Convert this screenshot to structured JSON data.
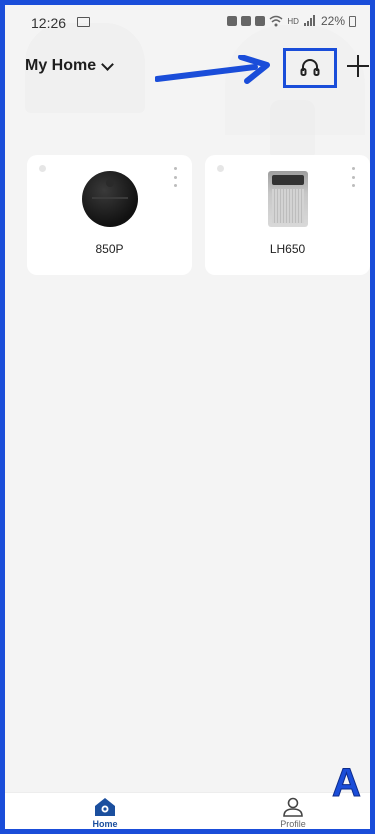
{
  "status_bar": {
    "time": "12:26",
    "network": "HD",
    "battery": "22%"
  },
  "header": {
    "home_title": "My Home"
  },
  "devices": [
    {
      "name": "850P",
      "icon": "robot-vacuum"
    },
    {
      "name": "LH650",
      "icon": "air-purifier"
    }
  ],
  "bottom_nav": {
    "home_label": "Home",
    "profile_label": "Profile"
  },
  "annotation": {
    "letter": "A",
    "color": "#1a4dd9"
  },
  "colors": {
    "accent": "#1b4f9e",
    "annotation": "#1a4dd9"
  }
}
